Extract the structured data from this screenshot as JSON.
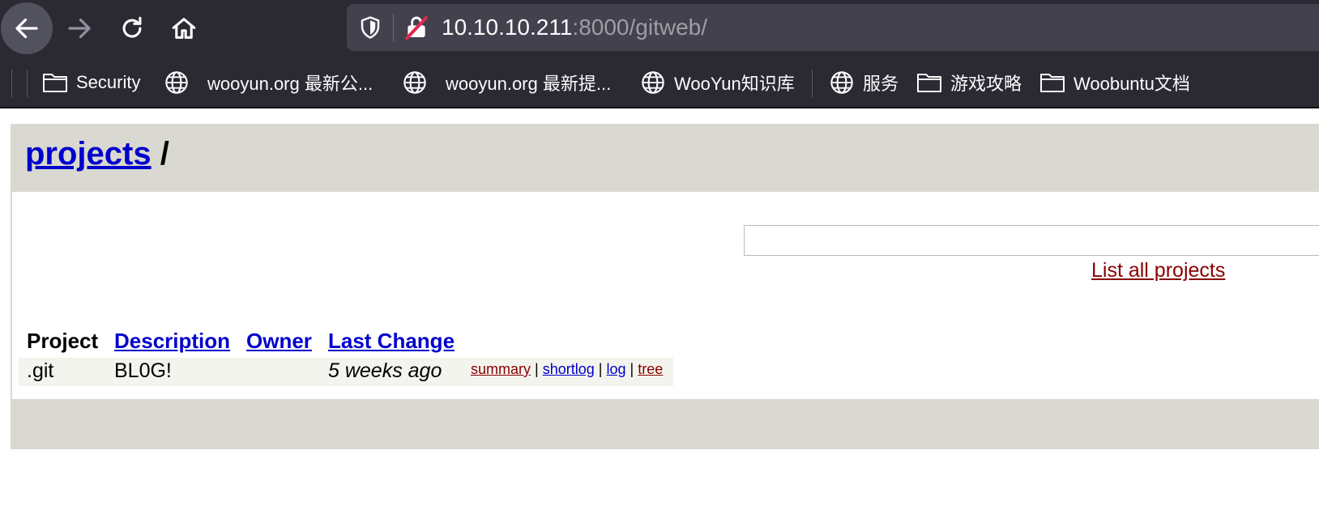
{
  "browser": {
    "url_host": "10.10.10.211",
    "url_path": ":8000/gitweb/",
    "bookmarks": [
      {
        "label": "Security",
        "icon": "folder-icon"
      },
      {
        "label": "wooyun.org 最新公...",
        "icon": "globe-icon"
      },
      {
        "label": "wooyun.org 最新提...",
        "icon": "globe-icon"
      },
      {
        "label": "WooYun知识库",
        "icon": "globe-icon"
      },
      {
        "label": "服务",
        "icon": "globe-icon"
      },
      {
        "label": "游戏攻略",
        "icon": "folder-icon"
      },
      {
        "label": "Woobuntu文档",
        "icon": "folder-icon"
      }
    ]
  },
  "page": {
    "breadcrumb_link": "projects",
    "breadcrumb_sep": "/",
    "search_value": "",
    "list_all_label": "List all projects",
    "table": {
      "headers": [
        "Project",
        "Description",
        "Owner",
        "Last Change"
      ],
      "rows": [
        {
          "project": ".git",
          "description": "BL0G!",
          "owner": "",
          "last_change": "5 weeks ago",
          "links": [
            "summary",
            "shortlog",
            "log",
            "tree"
          ]
        }
      ]
    }
  },
  "colors": {
    "chrome_bg": "#2b2a33",
    "urlbar_bg": "#42414d",
    "gitweb_header_bg": "#d9d8d1",
    "link_blue": "#0000cc",
    "link_red": "#880000",
    "row_bg": "#f4f4ee"
  }
}
